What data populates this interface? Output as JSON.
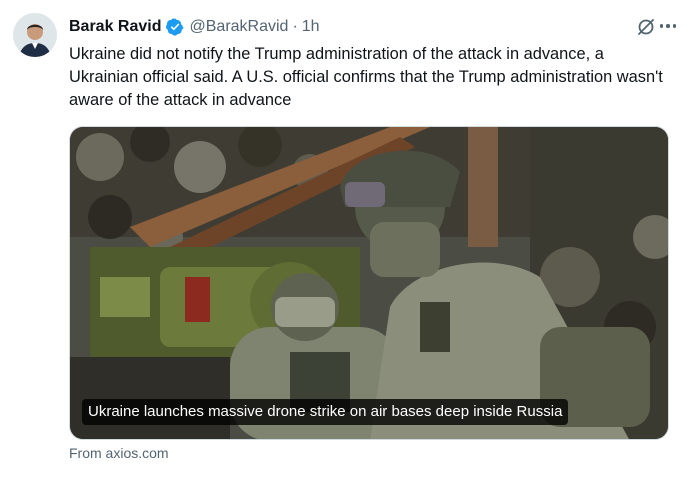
{
  "author": {
    "name": "Barak Ravid",
    "handle": "@BarakRavid",
    "separator": "·",
    "time": "1h"
  },
  "icons": {
    "avatar": "avatar",
    "verified": "verified-badge-icon",
    "grok": "grok-icon",
    "more": "more-icon"
  },
  "colors": {
    "verified": "#1d9bf0",
    "secondary_text": "#536471"
  },
  "tweet": {
    "text": "Ukraine did not notify the Trump administration of the attack in advance, a Ukrainian official said. A U.S. official confirms that the Trump administration wasn't aware of the attack in advance"
  },
  "card": {
    "caption": "Ukraine launches massive drone strike on air bases deep inside Russia",
    "source": "From axios.com"
  }
}
